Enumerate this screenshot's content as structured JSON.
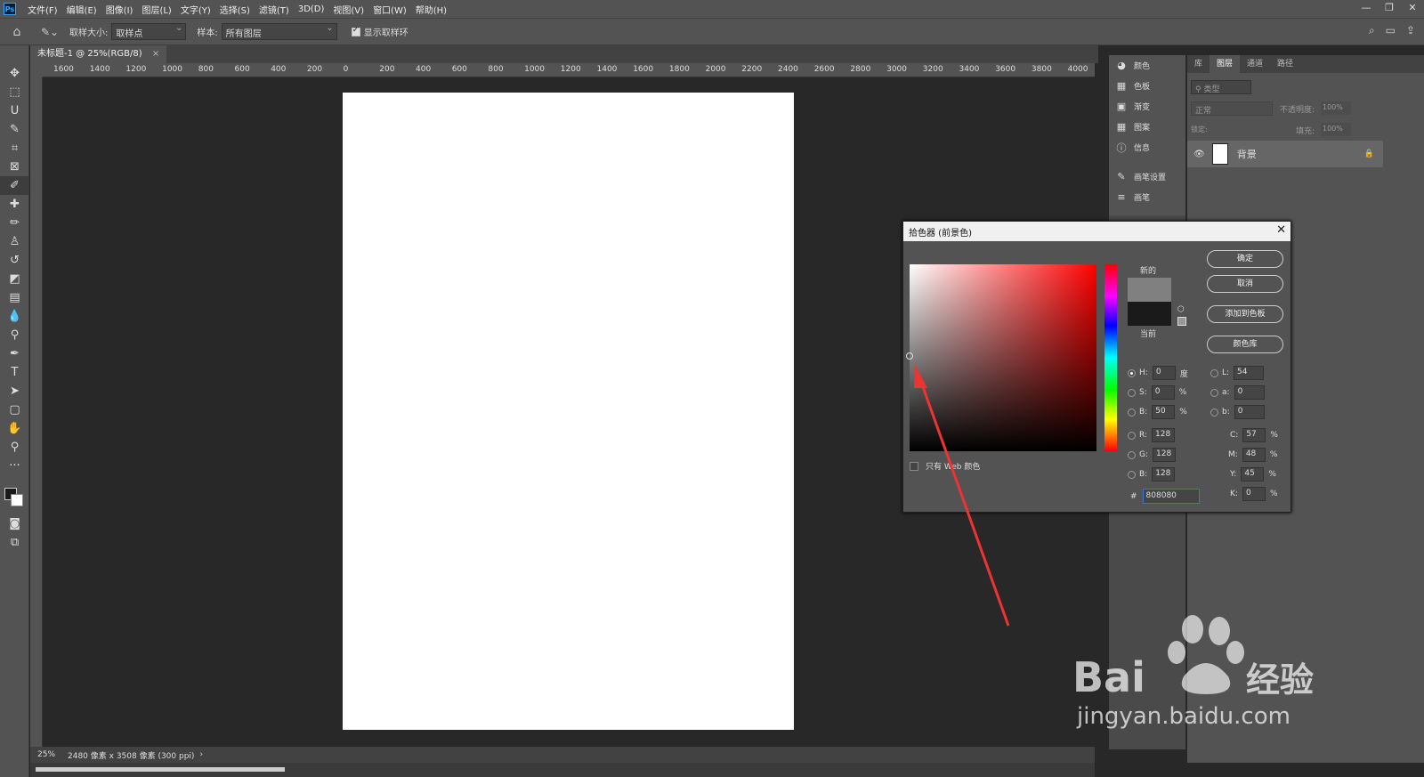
{
  "menubar": {
    "logo": "Ps",
    "items": [
      "文件(F)",
      "编辑(E)",
      "图像(I)",
      "图层(L)",
      "文字(Y)",
      "选择(S)",
      "滤镜(T)",
      "3D(D)",
      "视图(V)",
      "窗口(W)",
      "帮助(H)"
    ],
    "controls": [
      "—",
      "❐",
      "✕"
    ]
  },
  "options": {
    "sample_size_label": "取样大小:",
    "sample_size_value": "取样点",
    "sample_label": "样本:",
    "sample_value": "所有图层",
    "show_ring_label": "显示取样环"
  },
  "document": {
    "tab_label": "未标题-1 @ 25%(RGB/8)",
    "tab_close": "×",
    "zoom": "25%",
    "info": "2480 像素 x 3508 像素 (300 ppi)",
    "info_arrow": "›"
  },
  "ruler": {
    "h_labels": [
      "1600",
      "1400",
      "1200",
      "1000",
      "800",
      "600",
      "400",
      "200",
      "0",
      "200",
      "400",
      "600",
      "800",
      "1000",
      "1200",
      "1400",
      "1600",
      "1800",
      "2000",
      "2200",
      "2400",
      "2600",
      "2800",
      "3000",
      "3200",
      "3400",
      "3600",
      "3800",
      "4000"
    ]
  },
  "mid_panel": {
    "items": [
      {
        "icon": "palette-icon",
        "label": "颜色"
      },
      {
        "icon": "grid-icon",
        "label": "色板"
      },
      {
        "icon": "gradient-icon",
        "label": "渐变"
      },
      {
        "icon": "pattern-icon",
        "label": "图案"
      },
      {
        "icon": "info-icon",
        "label": "信息"
      },
      {
        "icon": "brush-settings-icon",
        "label": "画笔设置"
      },
      {
        "icon": "brush-icon",
        "label": "画笔"
      }
    ]
  },
  "right_panel": {
    "tabs": [
      "库",
      "图层",
      "通道",
      "路径"
    ],
    "search_placeholder": "类型",
    "blend_mode": "正常",
    "opacity_label": "不透明度:",
    "opacity_value": "100%",
    "lock_label": "锁定:",
    "fill_label": "填充:",
    "fill_value": "100%",
    "layer_name": "背景"
  },
  "picker": {
    "title": "拾色器 (前景色)",
    "new_label": "新的",
    "current_label": "当前",
    "buttons": {
      "ok": "确定",
      "cancel": "取消",
      "add": "添加到色板",
      "lib": "颜色库"
    },
    "web_only": "只有 Web 颜色",
    "hsb": {
      "h_label": "H:",
      "h": "0",
      "h_unit": "度",
      "s_label": "S:",
      "s": "0",
      "s_unit": "%",
      "b_label": "B:",
      "b": "50",
      "b_unit": "%"
    },
    "lab": {
      "l_label": "L:",
      "l": "54",
      "a_label": "a:",
      "a": "0",
      "b_label": "b:",
      "b": "0"
    },
    "rgb": {
      "r_label": "R:",
      "r": "128",
      "g_label": "G:",
      "g": "128",
      "b_label": "B:",
      "b": "128"
    },
    "cmyk": {
      "c_label": "C:",
      "c": "57",
      "m_label": "M:",
      "m": "48",
      "y_label": "Y:",
      "y": "45",
      "k_label": "K:",
      "k": "0",
      "unit": "%"
    },
    "hex_label": "#",
    "hex": "808080",
    "new_color": "#808080",
    "current_color": "#1a1a1a"
  },
  "watermark": {
    "brand": "Bai",
    "brand2": "经验",
    "url": "jingyan.baidu.com"
  }
}
